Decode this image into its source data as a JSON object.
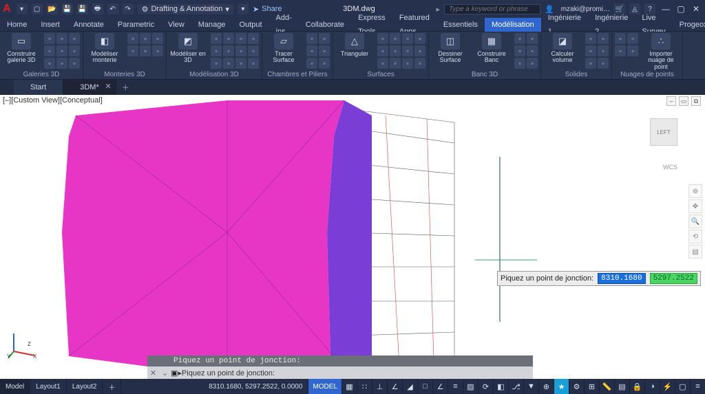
{
  "titlebar": {
    "workspace": "Drafting & Annotation",
    "share": "Share",
    "doc": "3DM.dwg",
    "search_placeholder": "Type a keyword or phrase",
    "user": "mzaki@promi…"
  },
  "menu": {
    "items": [
      "Home",
      "Insert",
      "Annotate",
      "Parametric",
      "View",
      "Manage",
      "Output",
      "Add-ins",
      "Collaborate",
      "Express Tools",
      "Featured Apps",
      "Essentiels",
      "Modélisation",
      "Ingénierie 1",
      "Ingénierie 2",
      "Live Survey",
      "Progeox"
    ],
    "active": "Modélisation"
  },
  "ribbon": {
    "panels": [
      {
        "label": "Galeries 3D",
        "big": {
          "txt": "Construire galerie 3D",
          "ico": "▭"
        }
      },
      {
        "label": "Monteries 3D",
        "big": {
          "txt": "Modéliser monterie",
          "ico": "◧"
        }
      },
      {
        "label": "Modélisation 3D",
        "big": {
          "txt": "Modéliser en 3D",
          "ico": "◩"
        }
      },
      {
        "label": "Chambres et Piliers",
        "big": {
          "txt": "Tracer Surface",
          "ico": "▱"
        }
      },
      {
        "label": "Surfaces",
        "big": {
          "txt": "Trianguler",
          "ico": "△"
        }
      },
      {
        "label": "Banc 3D",
        "big": {
          "txt": "Dessiner Surface",
          "ico": "◫"
        },
        "big2": {
          "txt": "Construire Banc",
          "ico": "▦"
        }
      },
      {
        "label": "Solides",
        "big": {
          "txt": "Calculer volume",
          "ico": "◪"
        }
      },
      {
        "label": "Nuages de points",
        "big": {
          "txt": "Importer nuage de point",
          "ico": "∴"
        }
      }
    ]
  },
  "doctabs": {
    "items": [
      {
        "label": "Start",
        "active": false
      },
      {
        "label": "3DM*",
        "active": true
      }
    ]
  },
  "canvas": {
    "viewlabel": "[–][Custom View][Conceptual]",
    "cube_face": "LEFT",
    "wcs": "WCS",
    "tooltip": {
      "label": "Piquez un point de jonction:",
      "val1": "8310.1680",
      "val2": "5297.2522"
    },
    "cmd_history": "Piquez un point de jonction:",
    "cmd_prompt": "▸Piquez un point de jonction:",
    "axis_labels": {
      "x": "X",
      "y": "Y",
      "z": "Z"
    }
  },
  "statusbar": {
    "tabs": [
      "Model",
      "Layout1",
      "Layout2"
    ],
    "coords": "8310.1680, 5297.2522, 0.0000",
    "model": "MODEL"
  }
}
